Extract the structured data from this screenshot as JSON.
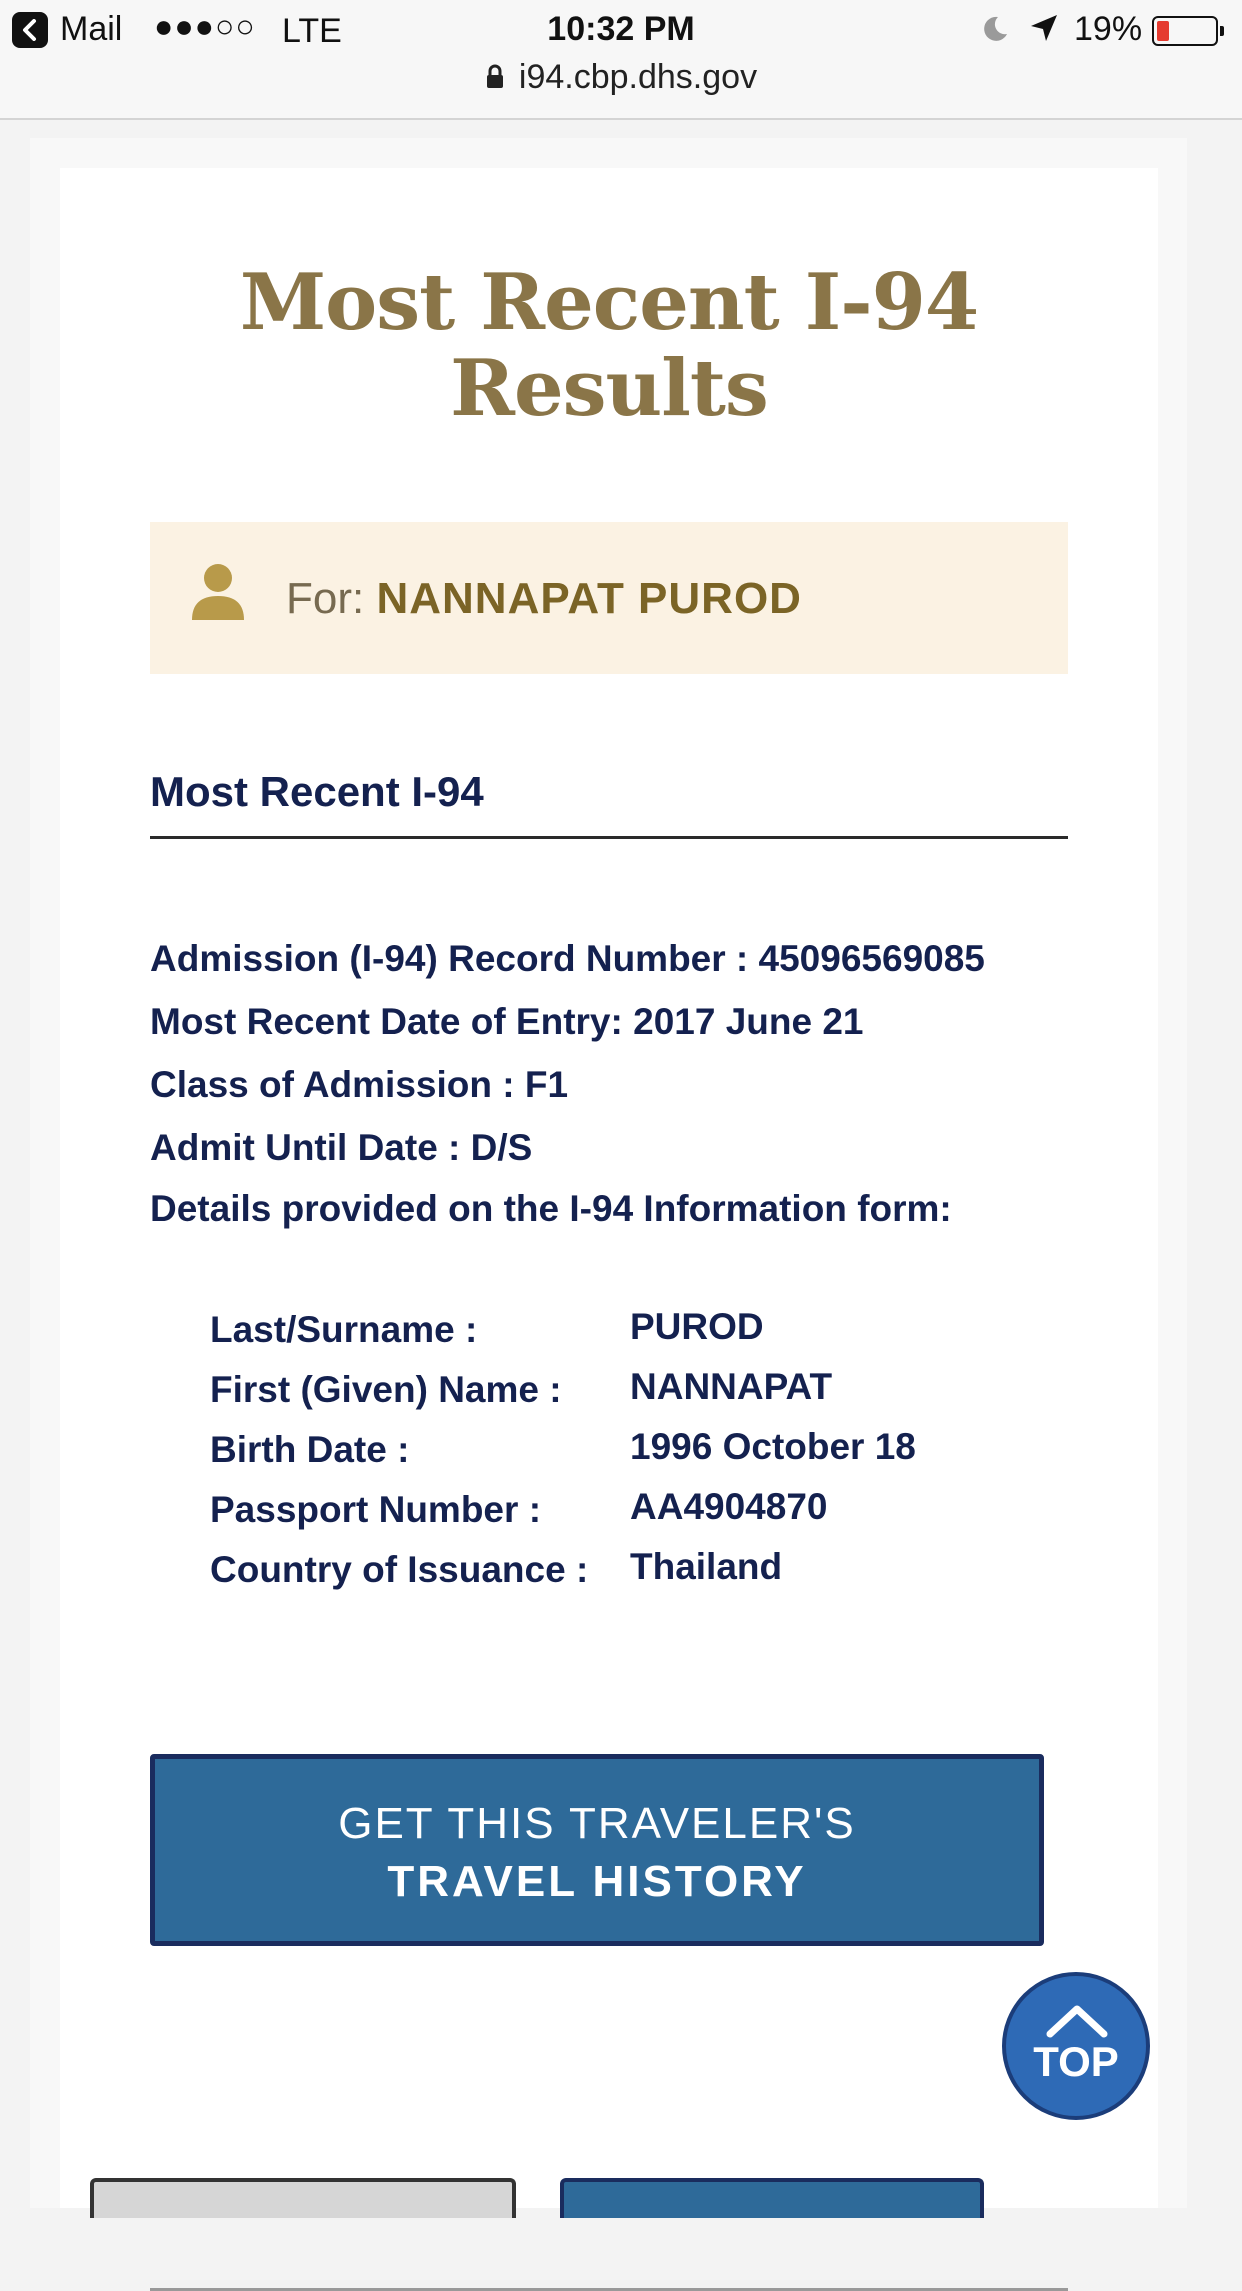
{
  "status_bar": {
    "back_label": "Mail",
    "signal": "●●●○○",
    "network": "LTE",
    "time": "10:32 PM",
    "battery_percent": "19%"
  },
  "browser": {
    "url": "i94.cbp.dhs.gov"
  },
  "page": {
    "title_line1": "Most Recent I-94",
    "title_line2": "Results",
    "for_label": "For:",
    "for_name": "NANNAPAT PUROD",
    "section_heading": "Most Recent I-94",
    "record_number": "Admission (I-94) Record Number : 45096569085",
    "date_of_entry": "Most Recent Date of Entry: 2017 June 21",
    "class_of_admission": "Class of Admission : F1",
    "admit_until": "Admit Until Date : D/S",
    "details_intro": "Details provided on the I-94 Information form:",
    "details": [
      {
        "label": "Last/Surname :",
        "value": "PUROD"
      },
      {
        "label": "First (Given) Name :",
        "value": "NANNAPAT"
      },
      {
        "label": "Birth Date :",
        "value": "1996 October 18"
      },
      {
        "label": "Passport Number :",
        "value": "AA4904870"
      },
      {
        "label": "Country of Issuance :",
        "value": "Thailand"
      }
    ],
    "history_button_line1": "GET THIS TRAVELER'S",
    "history_button_line2": "TRAVEL HISTORY",
    "top_button_label": "TOP"
  },
  "colors": {
    "title_gold": "#8a7548",
    "navy_text": "#14214f",
    "banner_bg": "#fbf2e3",
    "button_blue": "#2e6a99",
    "top_button_blue": "#2e6ab6"
  },
  "icons": [
    "back-chevron-icon",
    "moon-icon",
    "location-arrow-icon",
    "battery-icon",
    "lock-icon",
    "person-icon",
    "chevron-up-icon"
  ]
}
